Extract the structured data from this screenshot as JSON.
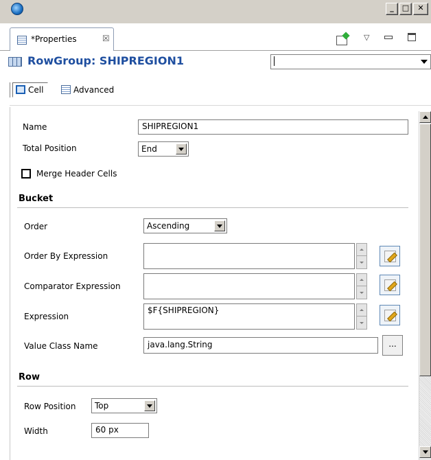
{
  "tab": {
    "label": "*Properties",
    "close": "☒"
  },
  "header": {
    "title": "RowGroup: SHIPREGION1",
    "combo_value": ""
  },
  "subtabs": [
    {
      "label": "Cell",
      "icon": "cell-icon"
    },
    {
      "label": "Advanced",
      "icon": "table-icon"
    }
  ],
  "form": {
    "name_label": "Name",
    "name_value": "SHIPREGION1",
    "total_position_label": "Total Position",
    "total_position_value": "End",
    "merge_header_label": "Merge Header Cells",
    "merge_header_checked": false
  },
  "bucket": {
    "title": "Bucket",
    "order_label": "Order",
    "order_value": "Ascending",
    "order_by_label": "Order By Expression",
    "order_by_value": "",
    "comparator_label": "Comparator Expression",
    "comparator_value": "",
    "expression_label": "Expression",
    "expression_value": "$F{SHIPREGION}",
    "value_class_label": "Value Class Name",
    "value_class_value": "java.lang.String",
    "browse_label": "..."
  },
  "row": {
    "title": "Row",
    "position_label": "Row Position",
    "position_value": "Top",
    "width_label": "Width",
    "width_value": "60 px"
  },
  "colors": {
    "title_blue": "#1f4fa0",
    "chrome": "#d4d0c8"
  }
}
